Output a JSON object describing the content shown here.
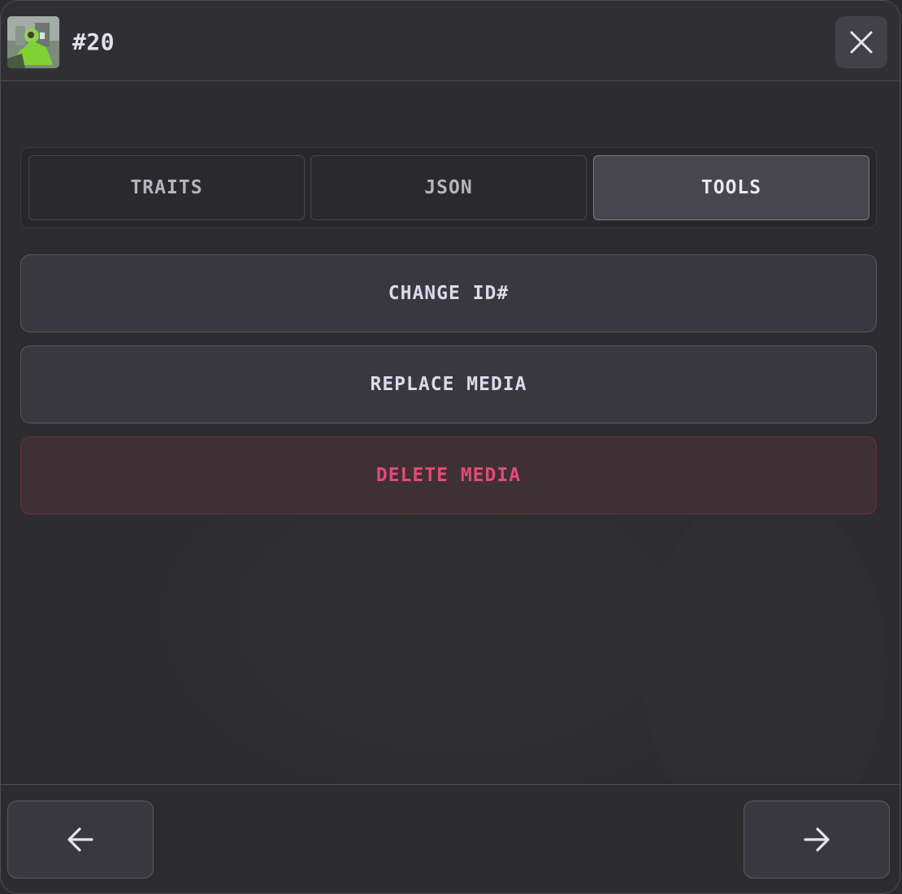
{
  "header": {
    "title": "#20",
    "thumbnail_icon": "nft-thumbnail",
    "close_icon": "close-icon"
  },
  "tabs": [
    {
      "label": "TRAITS",
      "active": false
    },
    {
      "label": "JSON",
      "active": false
    },
    {
      "label": "TOOLS",
      "active": true
    }
  ],
  "tools": {
    "change_id_label": "CHANGE ID#",
    "replace_media_label": "REPLACE MEDIA",
    "delete_media_label": "DELETE MEDIA"
  },
  "footer": {
    "prev_icon": "arrow-left-icon",
    "next_icon": "arrow-right-icon"
  },
  "colors": {
    "background": "#2c2c2f",
    "active_tab": "#46464c",
    "danger_text": "#e34a78",
    "danger_bg": "#3f3035",
    "text": "#dcd9ec"
  }
}
